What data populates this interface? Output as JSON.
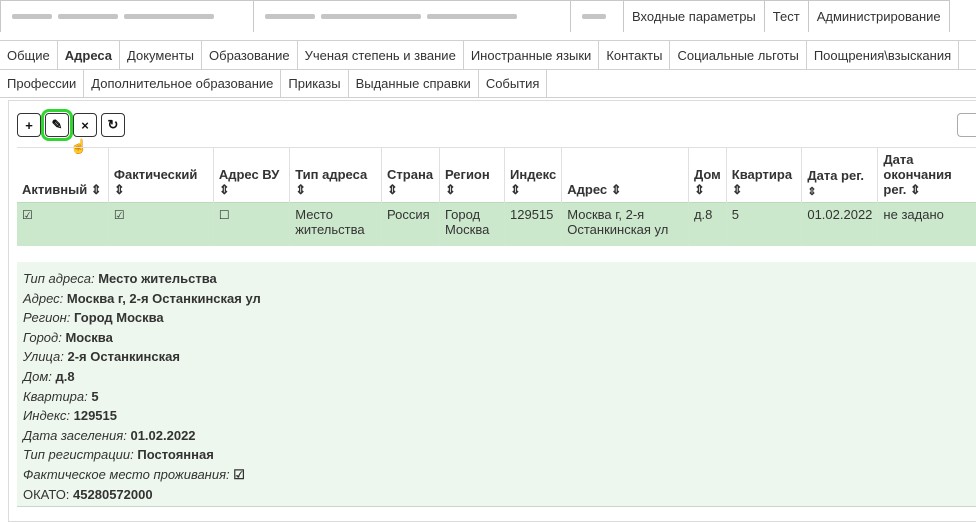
{
  "header": {
    "tabs": [
      "Входные параметры",
      "Тест",
      "Администрирование"
    ]
  },
  "tabs_row1": [
    "Общие",
    "Адреса",
    "Документы",
    "Образование",
    "Ученая степень и звание",
    "Иностранные языки",
    "Контакты",
    "Социальные льготы",
    "Поощрения\\взыскания"
  ],
  "tabs_row2": [
    "Профессии",
    "Дополнительное образование",
    "Приказы",
    "Выданные справки",
    "События"
  ],
  "active_tab": "Адреса",
  "toolbar": {
    "add_icon": "+",
    "edit_icon": "✎",
    "delete_icon": "×",
    "refresh_icon": "↻"
  },
  "sort_icon": "⇕",
  "table": {
    "columns": [
      {
        "l1": "",
        "l2": "",
        "l3": "Активный ⇕"
      },
      {
        "l1": "",
        "l2": "",
        "l3": "Фактический ⇕"
      },
      {
        "l1": "",
        "l2": "",
        "l3": "Адрес ВУ ⇕"
      },
      {
        "l1": "",
        "l2": "Тип адреса",
        "l3": "⇕"
      },
      {
        "l1": "",
        "l2": "Страна",
        "l3": "⇕"
      },
      {
        "l1": "",
        "l2": "",
        "l3": "Регион ⇕"
      },
      {
        "l1": "",
        "l2": "Индекс",
        "l3": "⇕"
      },
      {
        "l1": "",
        "l2": "",
        "l3": "Адрес ⇕"
      },
      {
        "l1": "",
        "l2": "Дом",
        "l3": "⇕"
      },
      {
        "l1": "",
        "l2": "Квартира",
        "l3": "⇕"
      },
      {
        "l1": "",
        "l2": "",
        "l3": "Дата рег."
      },
      {
        "l1": "Дата",
        "l2": "окончания",
        "l3": "рег. ⇕"
      }
    ],
    "row": {
      "active": "☑",
      "actual": "☑",
      "vu": "☐",
      "type": "Место жительства",
      "country": "Россия",
      "region": "Город Москва",
      "index": "129515",
      "address": "Москва г, 2-я Останкинская ул",
      "house": "д.8",
      "flat": "5",
      "reg_date": "01.02.2022",
      "end_date": "не задано"
    }
  },
  "details": [
    {
      "k": "Тип адреса:",
      "v": "Место жительства"
    },
    {
      "k": "Адрес:",
      "v": "Москва г, 2-я Останкинская ул"
    },
    {
      "k": "Регион:",
      "v": "Город Москва"
    },
    {
      "k": "Город:",
      "v": "Москва"
    },
    {
      "k": "Улица:",
      "v": "2-я Останкинская"
    },
    {
      "k": "Дом:",
      "v": "д.8"
    },
    {
      "k": "Квартира:",
      "v": "5"
    },
    {
      "k": "Индекс:",
      "v": "129515"
    },
    {
      "k": "Дата заселения:",
      "v": "01.02.2022"
    },
    {
      "k": "Тип регистрации:",
      "v": "Постоянная"
    },
    {
      "k": "Фактическое место проживания:",
      "v": "☑"
    },
    {
      "k": "ОКАТО:",
      "v": "45280572000"
    }
  ]
}
